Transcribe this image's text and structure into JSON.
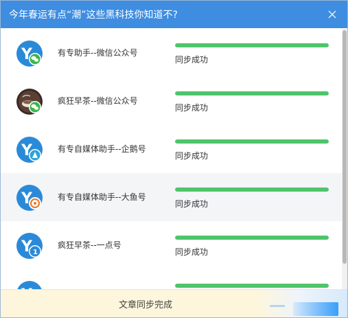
{
  "dialog": {
    "title": "今年春运有点“潮”这些黑科技你知道不?"
  },
  "rows": [
    {
      "name": "有专助手--微信公众号",
      "status": "同步成功",
      "progress": 1.0,
      "badge": "wechat-badge-icon",
      "avatar": "yzs-logo"
    },
    {
      "name": "疯狂早茶--微信公众号",
      "status": "同步成功",
      "progress": 1.0,
      "badge": "wechat-badge-icon",
      "avatar": "tea-cup-photo"
    },
    {
      "name": "有专自媒体助手--企鹅号",
      "status": "同步成功",
      "progress": 1.0,
      "badge": "penguin-badge-icon",
      "avatar": "yzs-logo"
    },
    {
      "name": "有专自媒体助手--大鱼号",
      "status": "同步成功",
      "progress": 1.0,
      "badge": "dayu-badge-icon",
      "avatar": "yzs-logo"
    },
    {
      "name": "疯狂早茶--一点号",
      "status": "同步成功",
      "progress": 1.0,
      "badge": "yidian-badge-icon",
      "avatar": "yzs-logo"
    }
  ],
  "footer": {
    "text": "文章同步完成"
  },
  "colors": {
    "title_bar": "#3e8de0",
    "progress_fill": "#4fc46b",
    "logo_blue": "#2a8ad8"
  }
}
